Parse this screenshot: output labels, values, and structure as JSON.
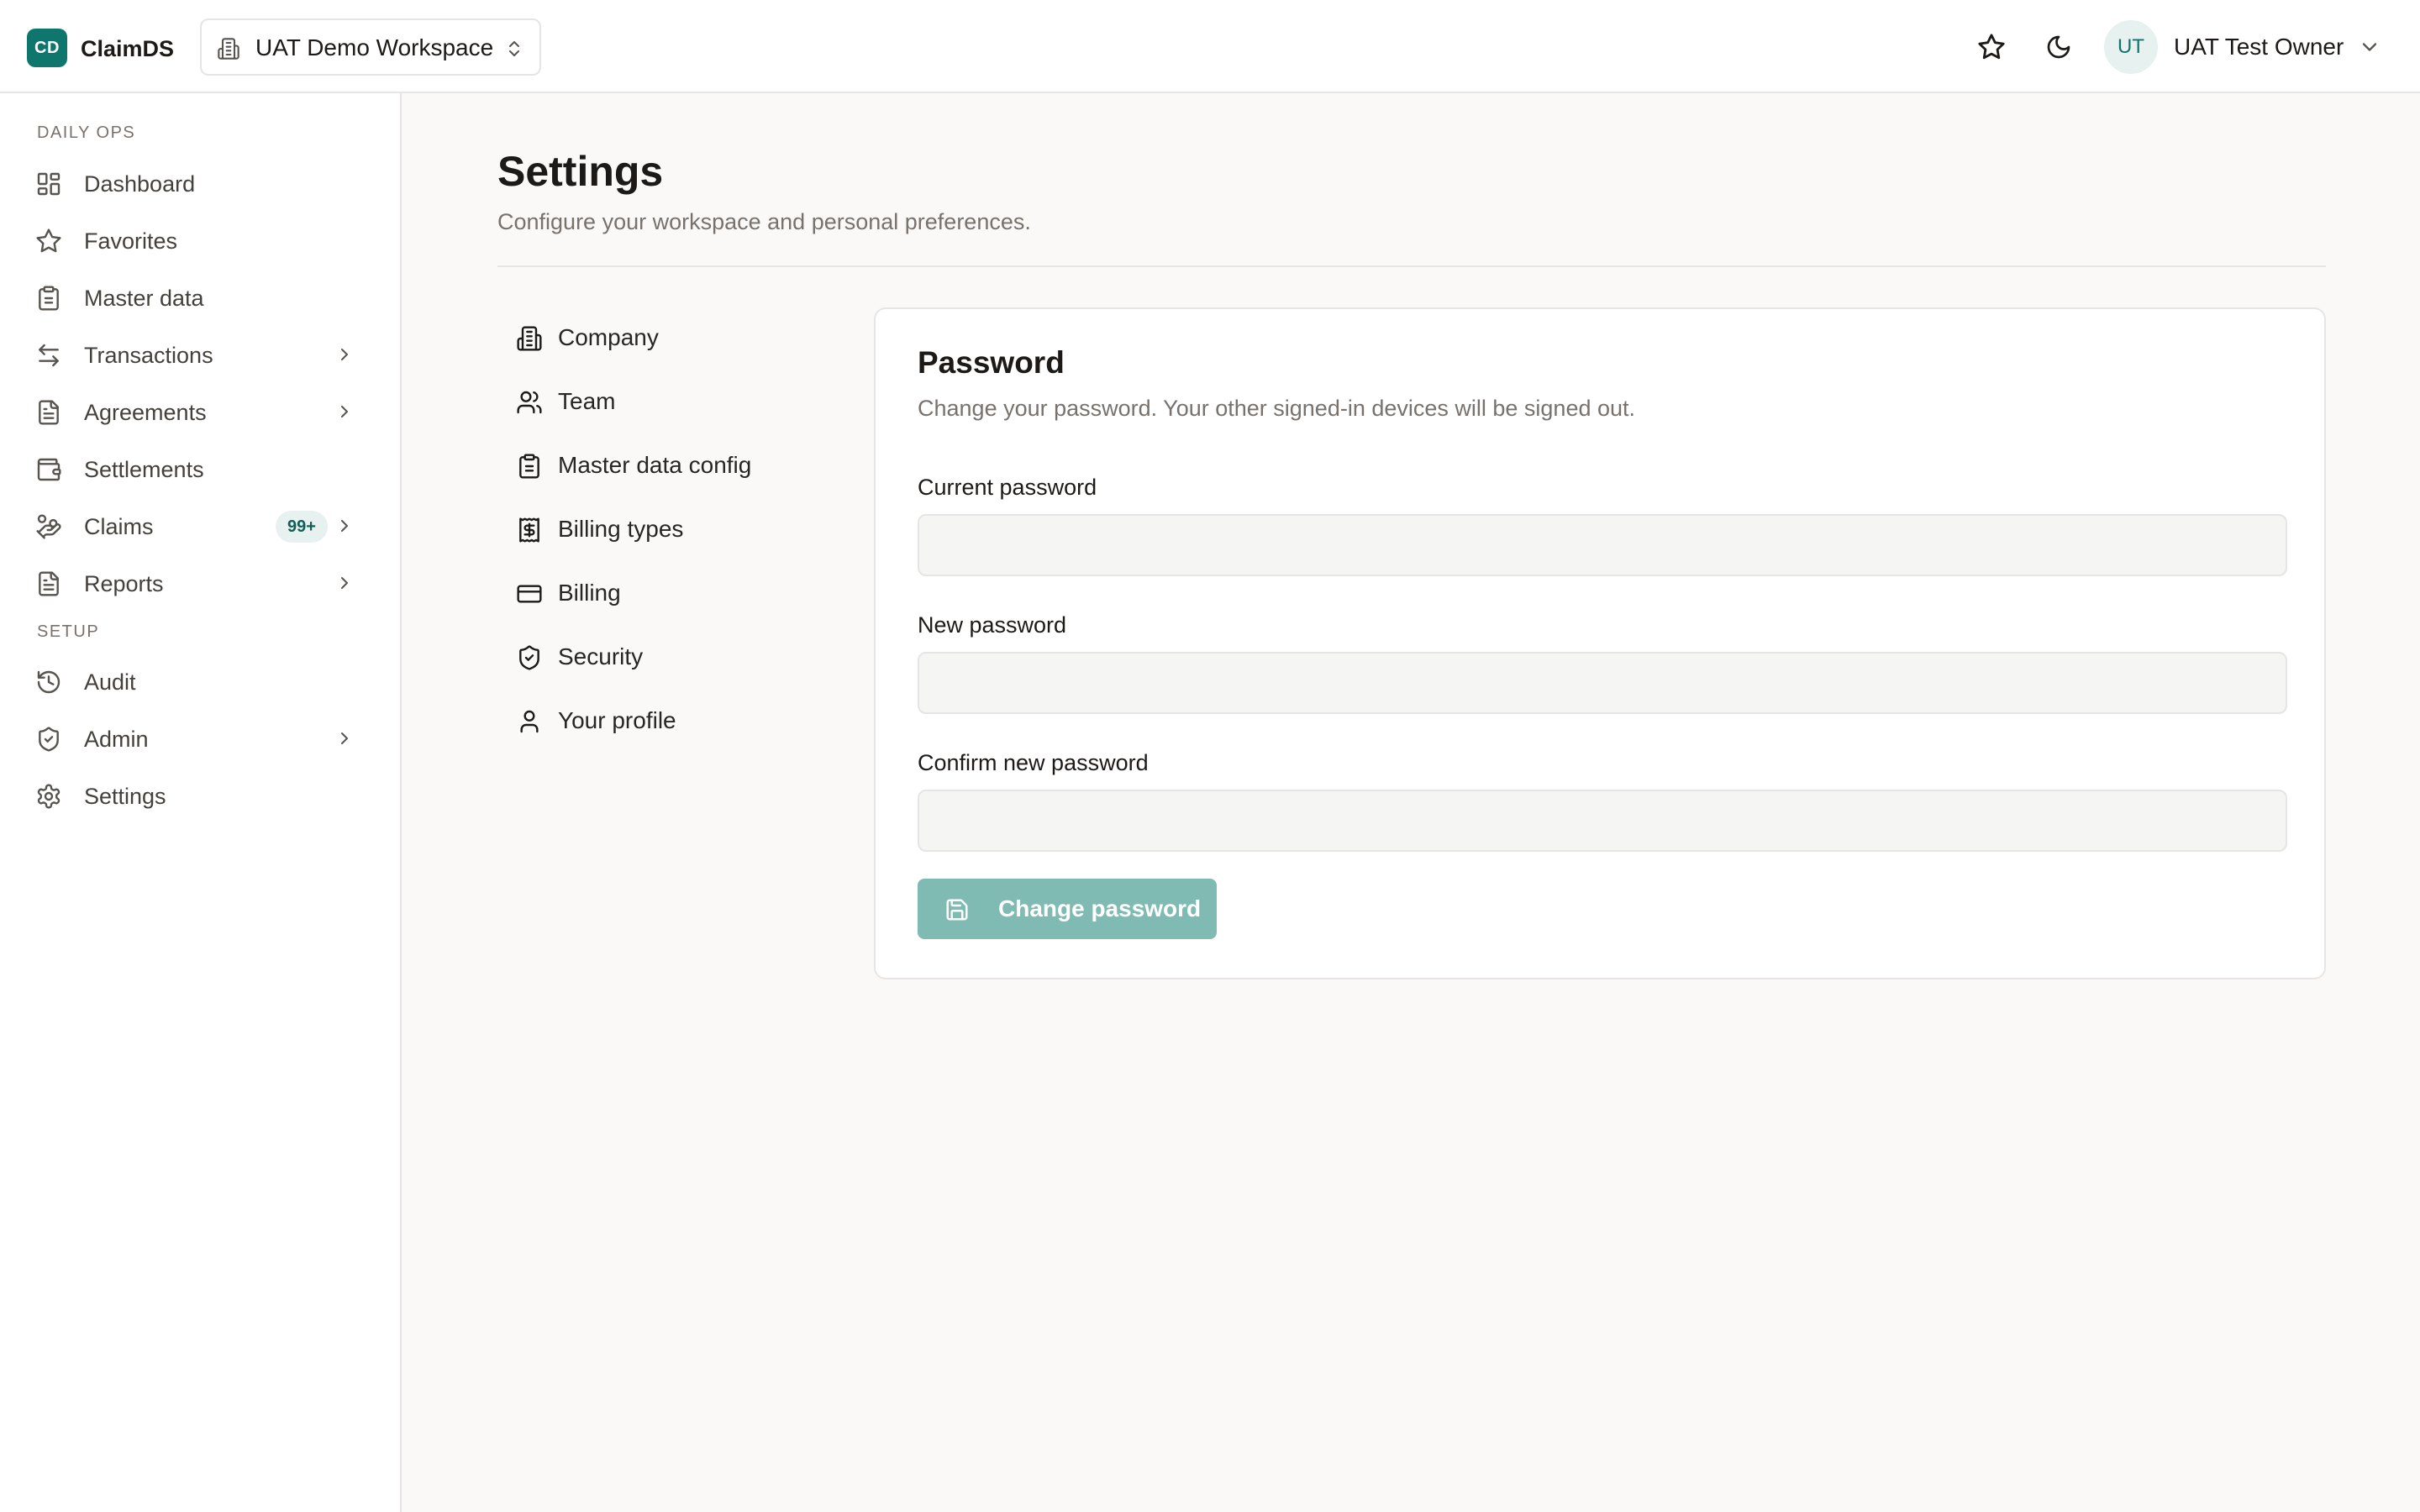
{
  "app": {
    "logo_initials": "CD",
    "name": "ClaimDS"
  },
  "workspace": {
    "current": "UAT Demo Workspace"
  },
  "user": {
    "initials": "UT",
    "name": "UAT Test Owner"
  },
  "sidebar": {
    "sections": [
      {
        "label": "DAILY OPS"
      },
      {
        "label": "SETUP"
      }
    ],
    "items": [
      {
        "label": "Dashboard",
        "icon": "dashboard-grid-icon"
      },
      {
        "label": "Favorites",
        "icon": "star-icon"
      },
      {
        "label": "Master data",
        "icon": "clipboard-icon"
      },
      {
        "label": "Transactions",
        "icon": "arrows-left-right-icon",
        "has_submenu": true
      },
      {
        "label": "Agreements",
        "icon": "document-icon",
        "has_submenu": true
      },
      {
        "label": "Settlements",
        "icon": "wallet-icon"
      },
      {
        "label": "Claims",
        "icon": "hand-coins-icon",
        "badge": "99+",
        "has_submenu": true
      },
      {
        "label": "Reports",
        "icon": "report-icon",
        "has_submenu": true
      },
      {
        "label": "Audit",
        "icon": "history-icon"
      },
      {
        "label": "Admin",
        "icon": "shield-icon",
        "has_submenu": true
      },
      {
        "label": "Settings",
        "icon": "gear-icon"
      }
    ]
  },
  "page": {
    "title": "Settings",
    "subtitle": "Configure your workspace and personal preferences."
  },
  "settings_nav": [
    {
      "label": "Company",
      "icon": "building-icon"
    },
    {
      "label": "Team",
      "icon": "users-icon"
    },
    {
      "label": "Master data config",
      "icon": "clipboard-icon"
    },
    {
      "label": "Billing types",
      "icon": "receipt-dollar-icon"
    },
    {
      "label": "Billing",
      "icon": "credit-card-icon"
    },
    {
      "label": "Security",
      "icon": "shield-check-icon"
    },
    {
      "label": "Your profile",
      "icon": "user-icon"
    }
  ],
  "password_card": {
    "title": "Password",
    "description": "Change your password. Your other signed-in devices will be signed out.",
    "fields": [
      {
        "label": "Current password",
        "value": ""
      },
      {
        "label": "New password",
        "value": ""
      },
      {
        "label": "Confirm new password",
        "value": ""
      }
    ],
    "submit_label": "Change password"
  },
  "colors": {
    "brand": "#0f766e",
    "button_disabled": "#7fbab3",
    "badge_bg": "#e7f1ef",
    "background": "#faf9f7"
  }
}
